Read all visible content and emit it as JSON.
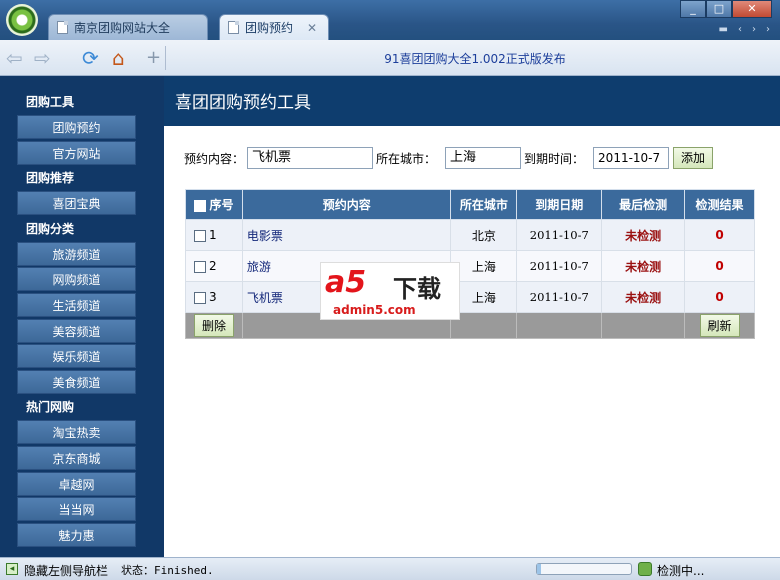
{
  "tabs": [
    {
      "label": "南京团购网站大全"
    },
    {
      "label": "团购预约",
      "active": true
    }
  ],
  "window": {
    "minimize": "_",
    "maximize": "□",
    "close": "✕"
  },
  "toolbar": {
    "notice": "91喜团团购大全1.002正式版发布"
  },
  "sidebar": {
    "groups": [
      {
        "title": "团购工具",
        "items": [
          "团购预约",
          "官方网站"
        ]
      },
      {
        "title": "团购推荐",
        "items": [
          "喜团宝典"
        ]
      },
      {
        "title": "团购分类",
        "items": [
          "旅游频道",
          "网购频道",
          "生活频道",
          "美容频道",
          "娱乐频道",
          "美食频道"
        ]
      },
      {
        "title": "热门网购",
        "items": [
          "淘宝热卖",
          "京东商城",
          "卓越网",
          "当当网",
          "魅力惠"
        ]
      }
    ]
  },
  "main": {
    "title": "喜团团购预约工具",
    "form": {
      "content_label": "预约内容：",
      "content_value": "飞机票",
      "city_label": "所在城市：",
      "city_value": "上海",
      "date_label": "到期时间：",
      "date_value": "2011-10-7",
      "add_label": "添加"
    },
    "table": {
      "columns": [
        "序号",
        "预约内容",
        "所在城市",
        "到期日期",
        "最后检测",
        "检测结果"
      ],
      "rows": [
        {
          "index": "1",
          "content": "电影票",
          "city": "北京",
          "date": "2011-10-7",
          "last_check": "未检测",
          "result": "0"
        },
        {
          "index": "2",
          "content": "旅游",
          "city": "上海",
          "date": "2011-10-7",
          "last_check": "未检测",
          "result": "0"
        },
        {
          "index": "3",
          "content": "飞机票",
          "city": "上海",
          "date": "2011-10-7",
          "last_check": "未检测",
          "result": "0"
        }
      ],
      "delete_label": "删除",
      "refresh_label": "刷新"
    }
  },
  "watermark": {
    "brand": "a5",
    "text": "下载",
    "url": "admin5.com"
  },
  "statusbar": {
    "toggle_label": "隐藏左侧导航栏",
    "status_text": "状态：Finished.",
    "detect_text": "检测中...",
    "progress": 0.04
  },
  "colors": {
    "accent": "#113867",
    "header": "#3b6a9c",
    "alert": "#c00000"
  }
}
